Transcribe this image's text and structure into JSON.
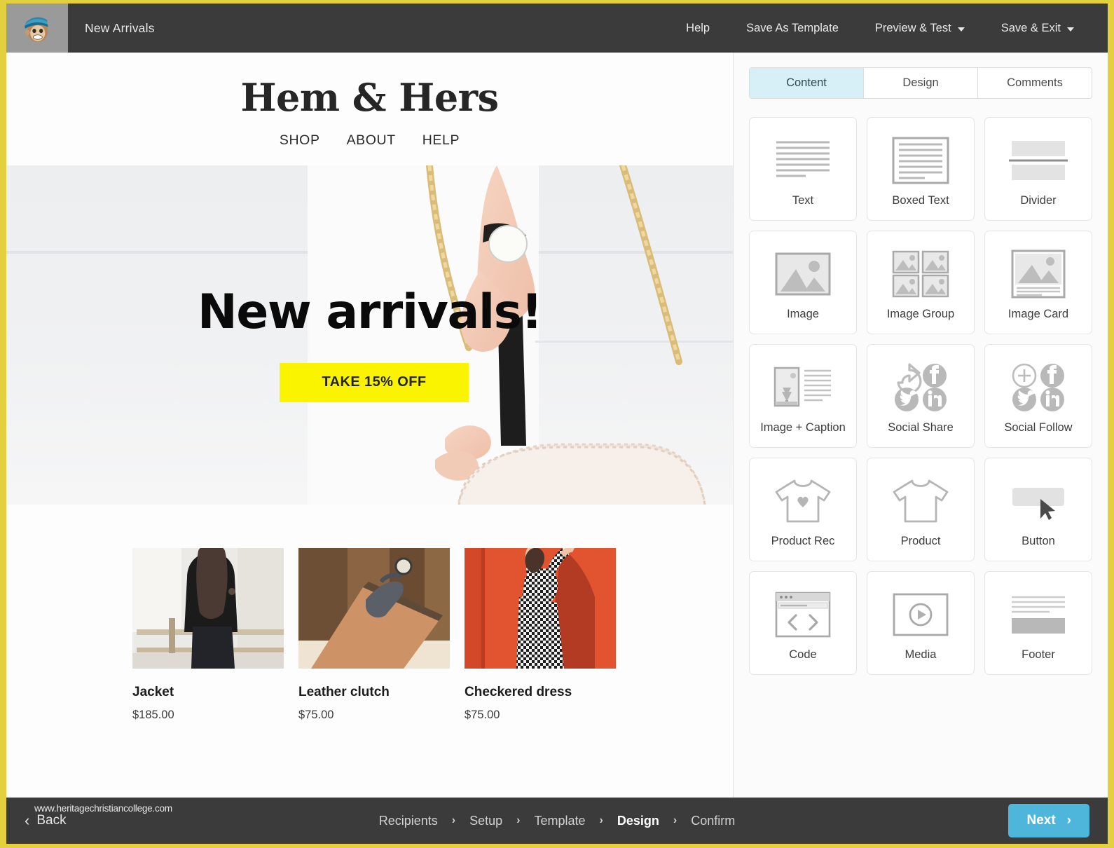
{
  "header": {
    "logo_alt": "mailchimp-freddie-logo",
    "title": "New Arrivals",
    "nav": [
      {
        "label": "Help",
        "caret": false
      },
      {
        "label": "Save As Template",
        "caret": false
      },
      {
        "label": "Preview & Test",
        "caret": true
      },
      {
        "label": "Save & Exit",
        "caret": true
      }
    ]
  },
  "email": {
    "brand": "Hem & Hers",
    "nav": [
      "SHOP",
      "ABOUT",
      "HELP"
    ],
    "hero": {
      "headline": "New arrivals!",
      "button_label": "TAKE 15% OFF",
      "button_color": "#FAF400",
      "image_alt": "woman-holding-blush-handbag-with-gold-chain"
    },
    "products": [
      {
        "name": "Jacket",
        "price": "$185.00",
        "image_alt": "woman-in-black-leather-jacket"
      },
      {
        "name": "Leather clutch",
        "price": "$75.00",
        "image_alt": "tan-leather-clutch-with-gloves"
      },
      {
        "name": "Checkered dress",
        "price": "$75.00",
        "image_alt": "woman-in-checkered-dress-on-orange-wall"
      }
    ]
  },
  "panel": {
    "tabs": [
      {
        "label": "Content",
        "active": true
      },
      {
        "label": "Design",
        "active": false
      },
      {
        "label": "Comments",
        "active": false
      }
    ],
    "active_tab_color": "#d7f0f7",
    "blocks": [
      {
        "label": "Text",
        "icon": "text-lines-icon"
      },
      {
        "label": "Boxed Text",
        "icon": "boxed-text-icon"
      },
      {
        "label": "Divider",
        "icon": "divider-icon"
      },
      {
        "label": "Image",
        "icon": "image-icon"
      },
      {
        "label": "Image Group",
        "icon": "image-group-icon"
      },
      {
        "label": "Image Card",
        "icon": "image-card-icon"
      },
      {
        "label": "Image + Caption",
        "icon": "image-caption-icon"
      },
      {
        "label": "Social Share",
        "icon": "social-share-icon"
      },
      {
        "label": "Social Follow",
        "icon": "social-follow-icon"
      },
      {
        "label": "Product Rec",
        "icon": "tshirt-heart-icon"
      },
      {
        "label": "Product",
        "icon": "tshirt-icon"
      },
      {
        "label": "Button",
        "icon": "button-cursor-icon"
      },
      {
        "label": "Code",
        "icon": "code-window-icon"
      },
      {
        "label": "Media",
        "icon": "play-button-icon"
      },
      {
        "label": "Footer",
        "icon": "footer-icon"
      }
    ]
  },
  "footer": {
    "back_label": "Back",
    "watermark": "www.heritagechristiancollege.com",
    "steps": [
      {
        "label": "Recipients",
        "active": false
      },
      {
        "label": "Setup",
        "active": false
      },
      {
        "label": "Template",
        "active": false
      },
      {
        "label": "Design",
        "active": true
      },
      {
        "label": "Confirm",
        "active": false
      }
    ],
    "step_separator": "›",
    "next_label": "Next",
    "next_color": "#4fb6db"
  }
}
